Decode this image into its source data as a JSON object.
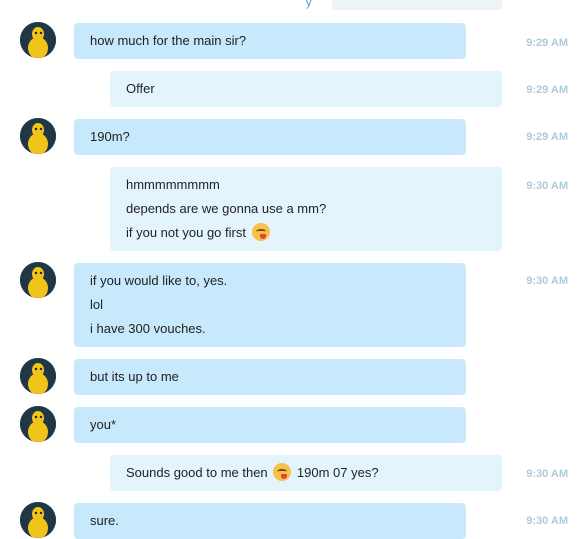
{
  "messages": [
    {
      "from": "them",
      "lines": [
        "how much for the main sir?"
      ],
      "time": "9:29 AM"
    },
    {
      "from": "me",
      "lines": [
        "Offer"
      ],
      "time": "9:29 AM"
    },
    {
      "from": "them",
      "lines": [
        "190m?"
      ],
      "time": "9:29 AM"
    },
    {
      "from": "me",
      "lines": [
        "hmmmmmmmm",
        "depends are we gonna use a mm?",
        "if you not you go first"
      ],
      "time": "9:30 AM"
    },
    {
      "from": "them",
      "lines": [
        "if you would like to, yes.",
        "lol",
        "i have 300 vouches."
      ],
      "time": "9:30 AM"
    },
    {
      "from": "them",
      "lines": [
        "but its up to me"
      ],
      "time": ""
    },
    {
      "from": "them",
      "lines": [
        "you*"
      ],
      "time": ""
    },
    {
      "from": "me",
      "lines": [
        "Sounds good to me then",
        "190m 07 yes?"
      ],
      "time": "9:30 AM"
    },
    {
      "from": "them",
      "lines": [
        "sure."
      ],
      "time": "9:30 AM"
    }
  ],
  "emoji": "savoring-food-emoji"
}
